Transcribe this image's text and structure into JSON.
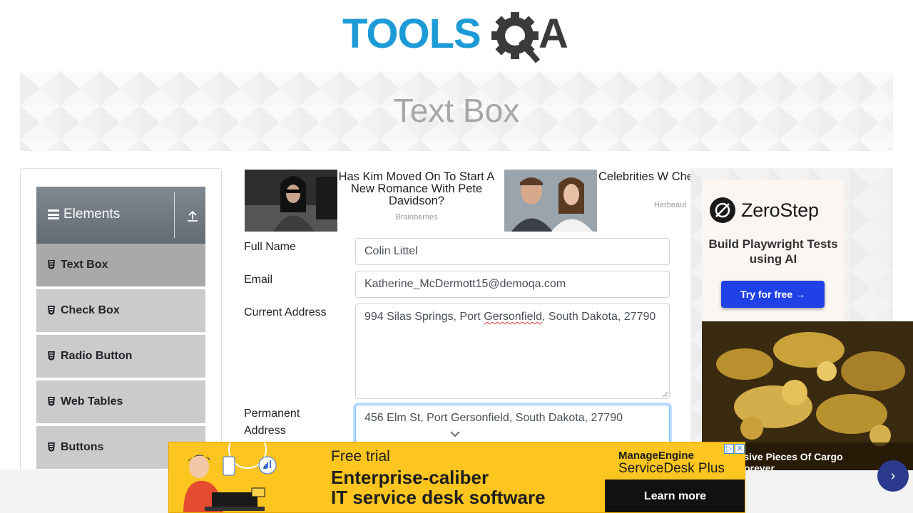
{
  "logo": {
    "text": "TOOLSQA",
    "colors": {
      "tools": "#1d9bd7",
      "qa": "#3b3b3b"
    }
  },
  "banner": {
    "title": "Text Box"
  },
  "sidebar": {
    "group": {
      "label": "Elements",
      "icon": "hamburger-icon",
      "toggle_icon": "collapse-up-icon"
    },
    "items": [
      {
        "label": "Text Box",
        "icon": "html5-icon",
        "active": true
      },
      {
        "label": "Check Box",
        "icon": "html5-icon"
      },
      {
        "label": "Radio Button",
        "icon": "html5-icon"
      },
      {
        "label": "Web Tables",
        "icon": "html5-icon"
      },
      {
        "label": "Buttons",
        "icon": "html5-icon"
      }
    ]
  },
  "ads_row": [
    {
      "headline": "Has Kim Moved On To Start A New Romance With Pete Davidson?",
      "source": "Brainberries"
    },
    {
      "headline": "Celebrities W Cheated On The",
      "source": "Herbeaut"
    }
  ],
  "form": {
    "full_name": {
      "label": "Full Name",
      "value": "Colin Littel"
    },
    "email": {
      "label": "Email",
      "value": "Katherine_McDermott15@demoqa.com"
    },
    "current_address": {
      "label": "Current Address",
      "value_pre": "994 Silas Springs, Port ",
      "value_word": "Gersonfield",
      "value_post": ", South Dakota, 27790"
    },
    "permanent_address": {
      "label": "Permanent Address",
      "value": "456 Elm St, Port Gersonfield, South Dakota, 27790"
    }
  },
  "right_ad": {
    "brand": "ZeroStep",
    "tagline": "Build Playwright Tests using AI",
    "cta": "Try for free →",
    "promo_caption_line1": "st Expensive Pieces Of Cargo",
    "promo_caption_line2": "re Lost Forever"
  },
  "bottom_ad": {
    "free_trial": "Free trial",
    "line1": "Enterprise-caliber",
    "line2": "IT service desk software",
    "brand_line1": "ManageEngine",
    "brand_line2": "ServiceDesk Plus",
    "cta": "Learn more",
    "adchoices_icon": "adchoices-icon",
    "close_icon": "close-icon"
  },
  "colors": {
    "accent_blue": "#1f41e6",
    "sidebar_active": "#a9a9a9",
    "sidebar_item": "#cbcbcb",
    "ad_yellow": "#fcc51f"
  }
}
